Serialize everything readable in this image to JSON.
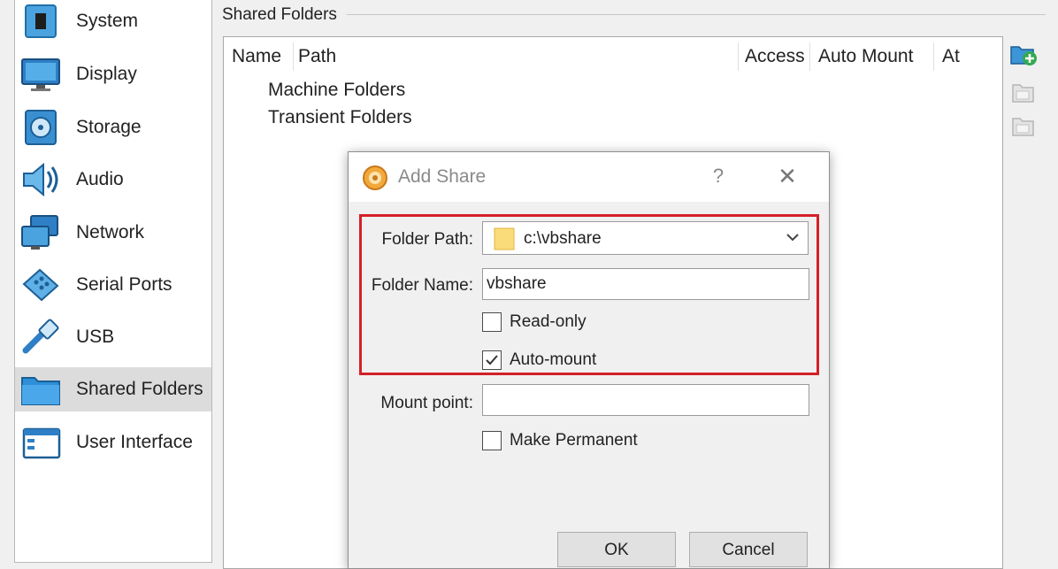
{
  "sidebar": {
    "items": [
      {
        "label": "System",
        "icon": "system-chip-icon"
      },
      {
        "label": "Display",
        "icon": "monitor-icon"
      },
      {
        "label": "Storage",
        "icon": "disk-icon"
      },
      {
        "label": "Audio",
        "icon": "speaker-icon"
      },
      {
        "label": "Network",
        "icon": "network-icon"
      },
      {
        "label": "Serial Ports",
        "icon": "serial-port-icon"
      },
      {
        "label": "USB",
        "icon": "usb-icon"
      },
      {
        "label": "Shared Folders",
        "icon": "folder-icon",
        "selected": true
      },
      {
        "label": "User Interface",
        "icon": "window-icon"
      }
    ]
  },
  "main": {
    "group_title": "Shared Folders",
    "table": {
      "columns": [
        "Name",
        "Path",
        "Access",
        "Auto Mount",
        "At"
      ],
      "rows": [
        "Machine Folders",
        "Transient Folders"
      ]
    },
    "side_buttons": [
      "add-share-icon",
      "edit-share-icon",
      "remove-share-icon"
    ]
  },
  "dialog": {
    "title": "Add Share",
    "help": "?",
    "close": "✕",
    "folder_path_label": "Folder Path:",
    "folder_path_value": "c:\\vbshare",
    "folder_name_label": "Folder Name:",
    "folder_name_value": "vbshare",
    "read_only_label": "Read-only",
    "read_only_checked": false,
    "auto_mount_label": "Auto-mount",
    "auto_mount_checked": true,
    "mount_point_label": "Mount point:",
    "mount_point_value": "",
    "make_permanent_label": "Make Permanent",
    "make_permanent_checked": false,
    "ok_label": "OK",
    "cancel_label": "Cancel",
    "highlight_color": "#d42027"
  }
}
